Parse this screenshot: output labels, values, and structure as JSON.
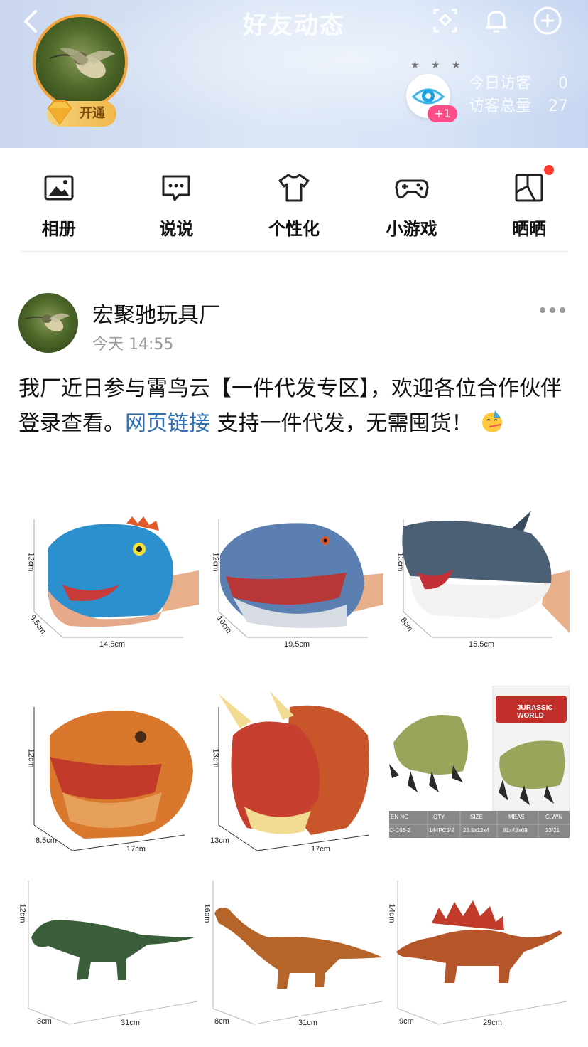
{
  "header": {
    "title": "好友动态",
    "vip_label": "开通",
    "visitors": {
      "stars": "★ ★ ★",
      "plus": "+1",
      "today_label": "今日访客",
      "today_value": "0",
      "total_label": "访客总量",
      "total_value": "27"
    }
  },
  "nav": {
    "items": [
      {
        "label": "相册",
        "icon": "photo-album-icon"
      },
      {
        "label": "说说",
        "icon": "chat-bubble-icon"
      },
      {
        "label": "个性化",
        "icon": "tshirt-icon"
      },
      {
        "label": "小游戏",
        "icon": "gamepad-icon"
      },
      {
        "label": "晒晒",
        "icon": "share-frame-icon"
      }
    ]
  },
  "post": {
    "author": "宏聚驰玩具厂",
    "time": "今天 14:55",
    "text_before": "我厂近日参与霄鸟云【一件代发专区】，欢迎各位合作伙伴登录查看。",
    "link": "网页链接",
    "text_after": " 支持一件代发，无需囤货！",
    "images": [
      {
        "name": "blue-trex-hand-puppet",
        "dims": [
          "12cm",
          "9.5cm",
          "14.5cm"
        ]
      },
      {
        "name": "blue-raptor-hand-puppet",
        "dims": [
          "12cm",
          "10cm",
          "19.5cm"
        ]
      },
      {
        "name": "shark-hand-puppet",
        "dims": [
          "13cm",
          "8cm",
          "15.5cm"
        ]
      },
      {
        "name": "orange-trex-hand-puppet",
        "dims": [
          "12cm",
          "8.5cm",
          "17cm"
        ]
      },
      {
        "name": "triceratops-hand-puppet",
        "dims": [
          "13cm",
          "13cm",
          "17cm"
        ]
      },
      {
        "name": "dino-claw-gloves",
        "dims": [
          "EN NO",
          "QTY",
          "SIZE",
          "MEAS",
          "G.W/N",
          "C-C06-2",
          "144PC5/2",
          "23.5x12x4",
          "81x48x69",
          "23/21"
        ],
        "brand": "JURASSIC WORLD"
      },
      {
        "name": "trex-figure",
        "dims": [
          "12cm",
          "8cm",
          "31cm"
        ]
      },
      {
        "name": "brachiosaurus-figure",
        "dims": [
          "16cm",
          "8cm",
          "31cm"
        ]
      },
      {
        "name": "stegosaurus-figure",
        "dims": [
          "14cm",
          "9cm",
          "29cm"
        ]
      }
    ]
  }
}
